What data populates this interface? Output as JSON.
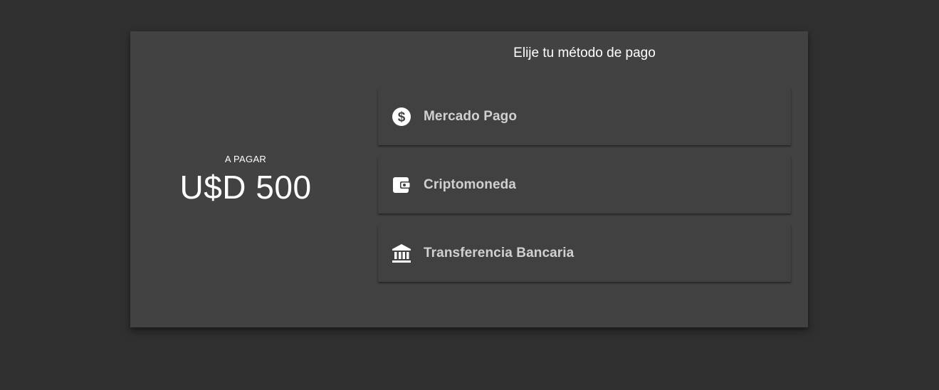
{
  "payment": {
    "amount_label": "A PAGAR",
    "amount_value": "U$D 500"
  },
  "methods": {
    "title": "Elije tu método de pago",
    "items": [
      {
        "label": "Mercado Pago",
        "icon": "dollar-circle-icon"
      },
      {
        "label": "Criptomoneda",
        "icon": "wallet-icon"
      },
      {
        "label": "Transferencia Bancaria",
        "icon": "bank-icon"
      }
    ]
  },
  "colors": {
    "background": "#303030",
    "card": "#424242",
    "method_card": "#414141",
    "text_primary": "#ffffff",
    "text_secondary": "#d0d0d0"
  }
}
